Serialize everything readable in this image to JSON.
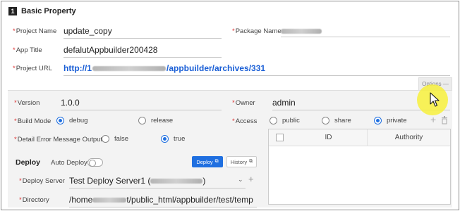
{
  "section": {
    "number": "1",
    "title": "Basic Property"
  },
  "fields": {
    "project_name": {
      "label": "Project Name",
      "value": "update_copy"
    },
    "package_name": {
      "label": "Package Name"
    },
    "app_title": {
      "label": "App Title",
      "value": "defalutAppbuilder200428"
    },
    "project_url": {
      "label": "Project URL",
      "prefix": "http://1",
      "suffix": "/appbuilder/archives/331"
    }
  },
  "options_tab": {
    "label": "Options —"
  },
  "version": {
    "label": "Version",
    "value": "1.0.0"
  },
  "owner": {
    "label": "Owner",
    "value": "admin"
  },
  "build_mode": {
    "label": "Build Mode",
    "options": [
      {
        "label": "debug",
        "selected": true
      },
      {
        "label": "release",
        "selected": false
      }
    ]
  },
  "access": {
    "label": "Access",
    "options": [
      {
        "label": "public",
        "selected": false
      },
      {
        "label": "share",
        "selected": false
      },
      {
        "label": "private",
        "selected": true
      }
    ]
  },
  "detail_error": {
    "label": "Detail Error Message Output",
    "options": [
      {
        "label": "false",
        "selected": false
      },
      {
        "label": "true",
        "selected": true
      }
    ]
  },
  "auth_table": {
    "columns": [
      "ID",
      "Authority"
    ]
  },
  "deploy": {
    "title": "Deploy",
    "auto_label": "Auto Deploy",
    "auto_enabled": false,
    "deploy_button": "Deploy",
    "history_button": "History",
    "server_label": "Deploy Server",
    "server_value": "Test Deploy Server1 (",
    "server_suffix": ")",
    "directory_label": "Directory",
    "directory_prefix": "/home",
    "directory_suffix": "t/public_html/appbuilder/test/temp"
  },
  "colors": {
    "accent": "#1f6fe0",
    "highlight": "#f7f03c",
    "required": "#d33333"
  }
}
